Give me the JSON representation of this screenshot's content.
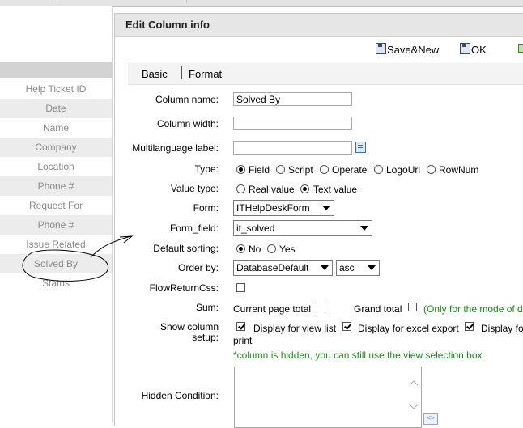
{
  "left_panel": {
    "items": [
      {
        "label": "Help Ticket ID"
      },
      {
        "label": "Date"
      },
      {
        "label": "Name"
      },
      {
        "label": "Company"
      },
      {
        "label": "Location"
      },
      {
        "label": "Phone #"
      },
      {
        "label": "Request For"
      },
      {
        "label": "Phone #"
      },
      {
        "label": "Issue Related"
      },
      {
        "label": "Solved By"
      },
      {
        "label": "Status"
      }
    ]
  },
  "dialog": {
    "title": "Edit Column info",
    "toolbar": {
      "save_new": "Save&New",
      "ok": "OK"
    },
    "tabs": [
      "Basic",
      "Format"
    ],
    "fields": {
      "column_name": {
        "label": "Column name:",
        "value": "Solved By"
      },
      "column_width": {
        "label": "Column width:",
        "value": ""
      },
      "multilanguage": {
        "label": "Multilanguage label:",
        "value": ""
      },
      "type": {
        "label": "Type:",
        "options": [
          "Field",
          "Script",
          "Operate",
          "LogoUrl",
          "RowNum"
        ],
        "selected": "Field"
      },
      "value_type": {
        "label": "Value type:",
        "options": [
          "Real value",
          "Text value"
        ],
        "selected": "Text value"
      },
      "form": {
        "label": "Form:",
        "value": "ITHelpDeskForm"
      },
      "form_field": {
        "label": "Form_field:",
        "value": "it_solved"
      },
      "default_sorting": {
        "label": "Default sorting:",
        "options": [
          "No",
          "Yes"
        ],
        "selected": "No"
      },
      "order_by": {
        "label": "Order by:",
        "value": "DatabaseDefault",
        "direction": "asc"
      },
      "flow_return_css": {
        "label": "FlowReturnCss:",
        "checked": false
      },
      "sum": {
        "label": "Sum:",
        "current_page_total": "Current page total",
        "grand_total": "Grand total",
        "note": "(Only for the mode of de"
      },
      "show_column_setup": {
        "label_line1": "Show column",
        "label_line2": "setup:",
        "view_list": "Display for view list",
        "excel_export": "Display for excel export",
        "display_fo": "Display fo",
        "print": "print",
        "hint": "*column is hidden, you can still use the view selection box"
      },
      "hidden_condition": {
        "label": "Hidden Condition:",
        "value": ""
      }
    }
  },
  "colors": {
    "hint_green": "#1a8a1a",
    "panel_text": "#8a8a8a",
    "title_bg": "#e6e6e6"
  }
}
